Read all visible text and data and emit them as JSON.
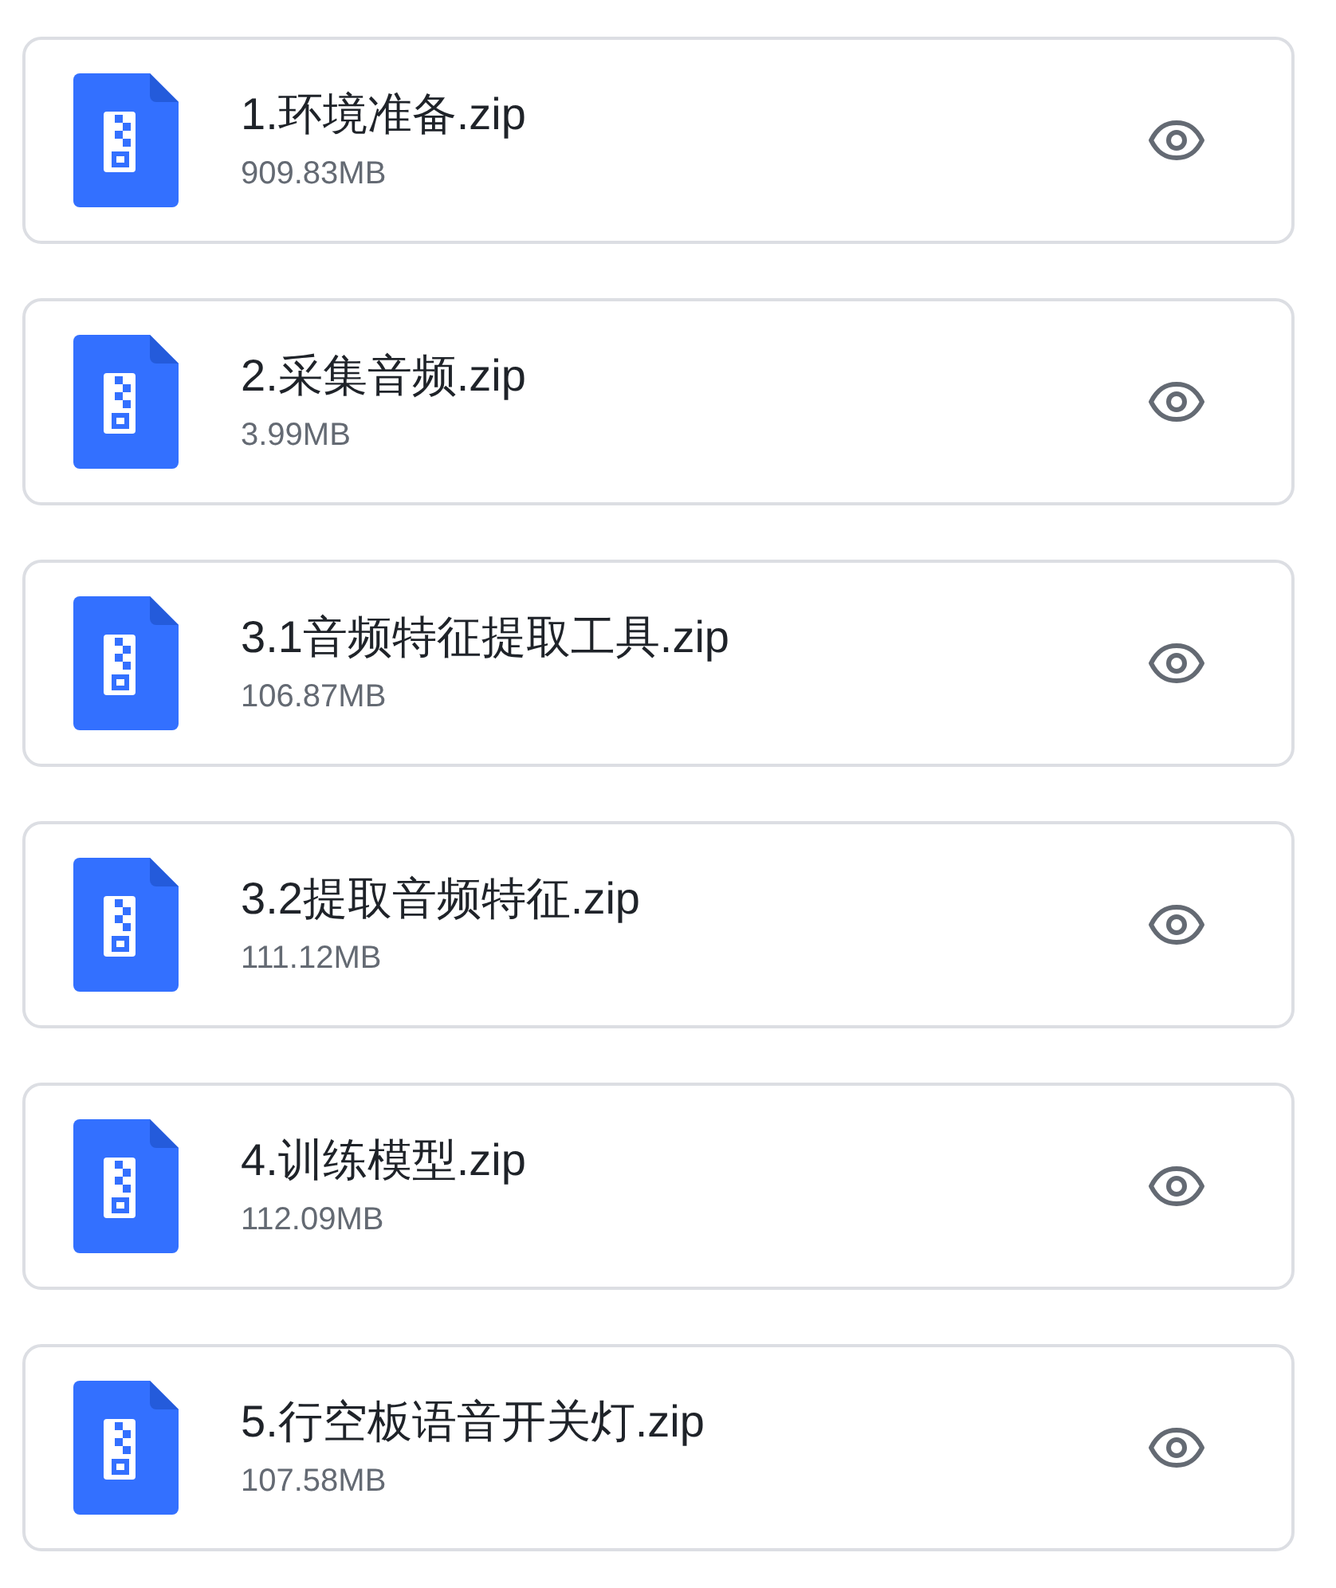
{
  "files": [
    {
      "name": "1.环境准备.zip",
      "size": "909.83MB"
    },
    {
      "name": "2.采集音频.zip",
      "size": "3.99MB"
    },
    {
      "name": "3.1音频特征提取工具.zip",
      "size": "106.87MB"
    },
    {
      "name": "3.2提取音频特征.zip",
      "size": "111.12MB"
    },
    {
      "name": "4.训练模型.zip",
      "size": "112.09MB"
    },
    {
      "name": "5.行空板语音开关灯.zip",
      "size": "107.58MB"
    }
  ]
}
